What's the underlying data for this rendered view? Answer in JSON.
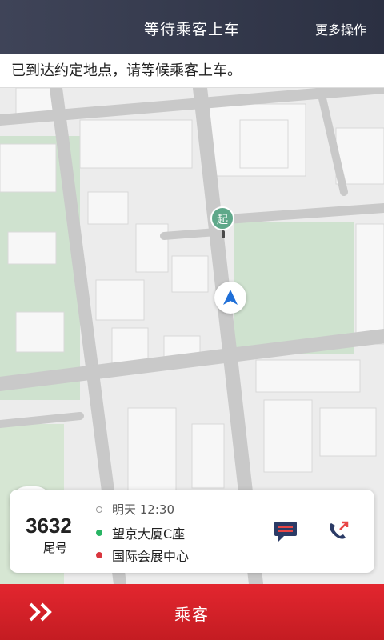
{
  "header": {
    "title": "等待乘客上车",
    "more": "更多操作"
  },
  "notice": {
    "text": "已到达约定地点，请等候乘客上车。"
  },
  "map": {
    "start_marker": "起",
    "colors": {
      "road": "#c8c8c8",
      "green": "#cfe2cf",
      "block": "#f6f6f6",
      "accent": "#1f6fd8"
    }
  },
  "controls": {
    "traffic_icon": "traffic-light-icon",
    "locate_icon": "locate-icon"
  },
  "order": {
    "tail_number": "3632",
    "tail_label": "尾号",
    "time": "明天 12:30",
    "from": "望京大厦C座",
    "to": "国际会展中心",
    "from_color": "#28b463",
    "to_color": "#d9363e"
  },
  "bottom": {
    "label": "乘客",
    "icon": "double-chevron-right-icon"
  }
}
